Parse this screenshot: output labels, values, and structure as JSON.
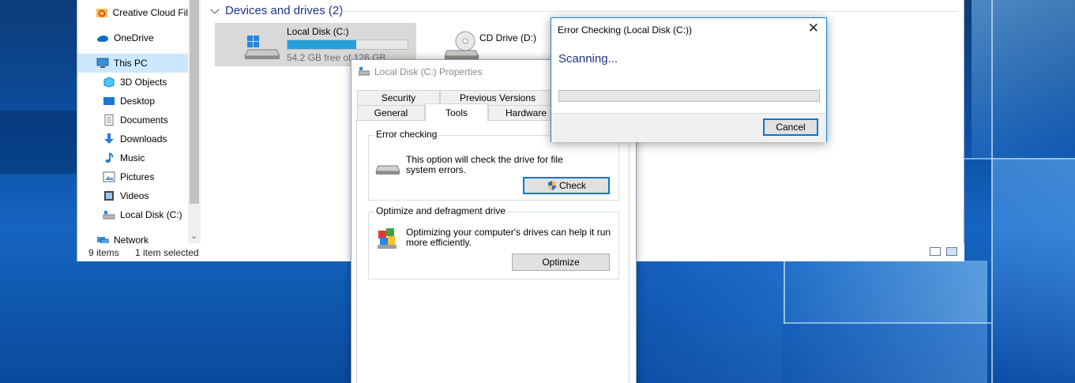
{
  "explorer": {
    "nav_items": [
      {
        "label": "Creative Cloud Fil",
        "icon": "creative-cloud-icon"
      },
      {
        "label": "OneDrive",
        "icon": "onedrive-icon"
      },
      {
        "label": "This PC",
        "icon": "this-pc-icon"
      },
      {
        "label": "3D Objects",
        "icon": "3d-objects-icon"
      },
      {
        "label": "Desktop",
        "icon": "desktop-icon"
      },
      {
        "label": "Documents",
        "icon": "documents-icon"
      },
      {
        "label": "Downloads",
        "icon": "downloads-icon"
      },
      {
        "label": "Music",
        "icon": "music-icon"
      },
      {
        "label": "Pictures",
        "icon": "pictures-icon"
      },
      {
        "label": "Videos",
        "icon": "videos-icon"
      },
      {
        "label": "Local Disk (C:)",
        "icon": "drive-icon"
      },
      {
        "label": "Network",
        "icon": "network-icon"
      }
    ],
    "selected_nav": "This PC",
    "group_header": "Devices and drives (2)",
    "drives": [
      {
        "name": "Local Disk (C:)",
        "free_text": "54.2 GB free of 126 GB",
        "used_fraction": 0.57
      },
      {
        "name": "CD Drive (D:)"
      }
    ],
    "status": {
      "count": "9 items",
      "selection": "1 item selected"
    }
  },
  "properties": {
    "title": "Local Disk (C:) Properties",
    "tabs_back": [
      "Security",
      "Previous Versions"
    ],
    "tabs_front": [
      "General",
      "Tools",
      "Hardware"
    ],
    "active_tab": "Tools",
    "error_checking": {
      "heading": "Error checking",
      "desc_line1": "This option will check the drive for file",
      "desc_line2": "system errors.",
      "button": "Check"
    },
    "optimize": {
      "heading": "Optimize and defragment drive",
      "desc_line1": "Optimizing your computer's drives can help it run",
      "desc_line2": "more efficiently.",
      "button": "Optimize"
    }
  },
  "error_dialog": {
    "title": "Error Checking (Local Disk (C:))",
    "status": "Scanning...",
    "progress": 0,
    "cancel": "Cancel",
    "close_glyph": "✕"
  },
  "colors": {
    "accent_blue": "#0078d7",
    "header_blue": "#1e3287",
    "drive_bar": "#26a0da",
    "selection": "#cce8ff"
  }
}
